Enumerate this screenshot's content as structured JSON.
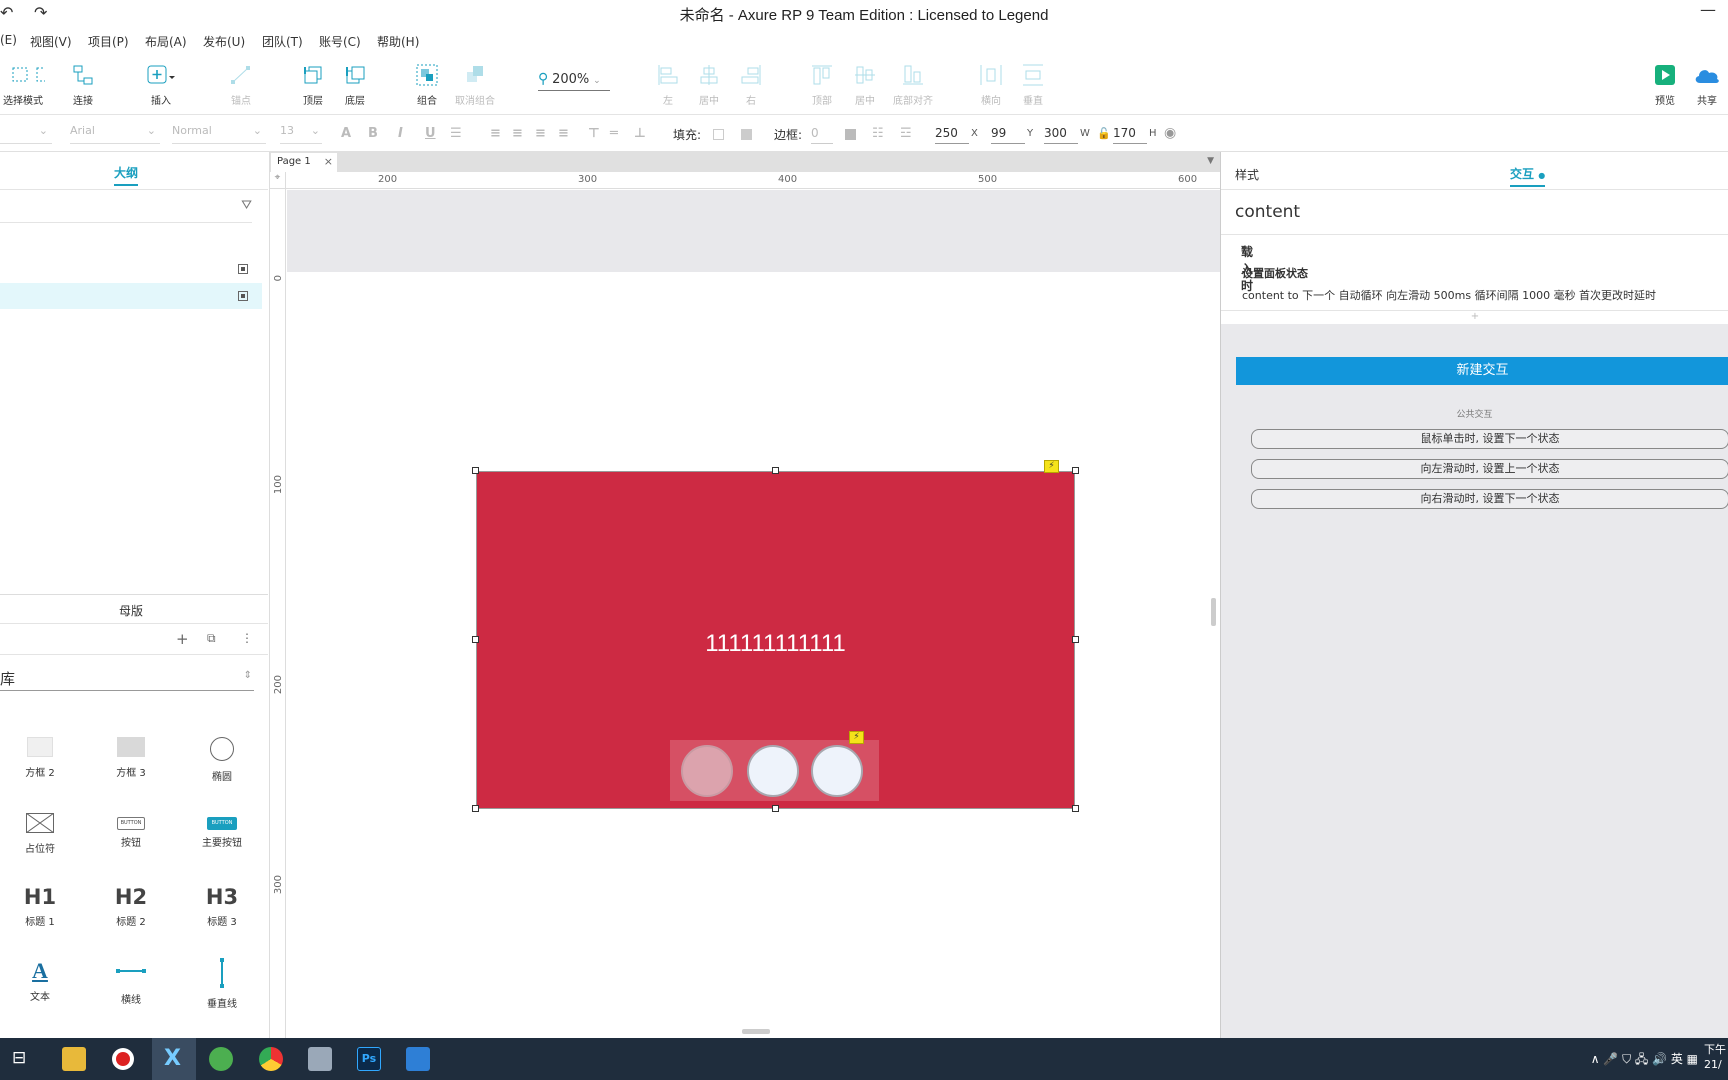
{
  "window": {
    "title": "未命名 - Axure RP 9 Team Edition : Licensed to Legend",
    "undo_icon": "undo-icon",
    "redo_icon": "redo-icon",
    "minimize_glyph": "—"
  },
  "menu": [
    "(E)",
    "视图(V)",
    "项目(P)",
    "布局(A)",
    "发布(U)",
    "团队(T)",
    "账号(C)",
    "帮助(H)"
  ],
  "toolbar": {
    "select_mode": "选择模式",
    "connect": "连接",
    "insert": "插入",
    "point": "锚点",
    "top": "顶层",
    "bottom": "底层",
    "group": "组合",
    "ungroup": "取消组合",
    "zoom": "200%",
    "left": "左",
    "center": "居中",
    "right": "右",
    "align_top": "顶部",
    "middle": "居中",
    "align_bottom": "底部对齐",
    "horizontal": "横向",
    "vertical": "垂直",
    "preview": "预览",
    "share": "共享",
    "accent_color": "#1a9fbf"
  },
  "format": {
    "font_family": "Arial",
    "font_style": "Normal",
    "font_size": "13",
    "fill_label": "填充:",
    "border_label": "边框:",
    "border_value": "0",
    "x": "250",
    "x_unit": "X",
    "y": "99",
    "y_unit": "Y",
    "w": "300",
    "w_unit": "W",
    "h": "170",
    "h_unit": "H"
  },
  "left_panel": {
    "outline_tab": "大纲",
    "masters_tab": "母版",
    "library_select": "库",
    "widgets": [
      {
        "label": "方框 2"
      },
      {
        "label": "方框 3"
      },
      {
        "label": "椭圆"
      },
      {
        "label": "占位符"
      },
      {
        "label": "按钮",
        "glyph": "BUTTON"
      },
      {
        "label": "主要按钮",
        "glyph": "BUTTON"
      },
      {
        "label": "标题 1",
        "glyph": "H1"
      },
      {
        "label": "标题 2",
        "glyph": "H2"
      },
      {
        "label": "标题 3",
        "glyph": "H3"
      },
      {
        "label": "文本",
        "glyph": "A"
      },
      {
        "label": "横线"
      },
      {
        "label": "垂直线"
      }
    ]
  },
  "canvas": {
    "page_tab": "Page 1",
    "ruler_h": [
      "200",
      "300",
      "400",
      "500",
      "600"
    ],
    "ruler_v": [
      "0",
      "100",
      "200",
      "300"
    ],
    "panel_text": "111111111111",
    "panel_color": "#cd2a43",
    "interaction_badge": "⚡"
  },
  "right_panel": {
    "tab_style": "样式",
    "tab_interaction": "交互",
    "widget_name": "content",
    "event": "载入时",
    "action_title": "设置面板状态",
    "action_detail": "content to 下一个 自动循环 向左滑动 500ms 循环间隔 1000 毫秒 首次更改时延时",
    "add_hint": "+",
    "new_interaction": "新建交互",
    "common_title": "公共交互",
    "common": [
      "鼠标单击时, 设置下一个状态",
      "向左滑动时, 设置上一个状态",
      "向右滑动时, 设置下一个状态"
    ]
  },
  "taskbar": {
    "sys_text": "∧ 🎤 ⛉ 🖧 🔊 英 ▦",
    "clock_line1": "下午",
    "clock_line2": "21/"
  }
}
